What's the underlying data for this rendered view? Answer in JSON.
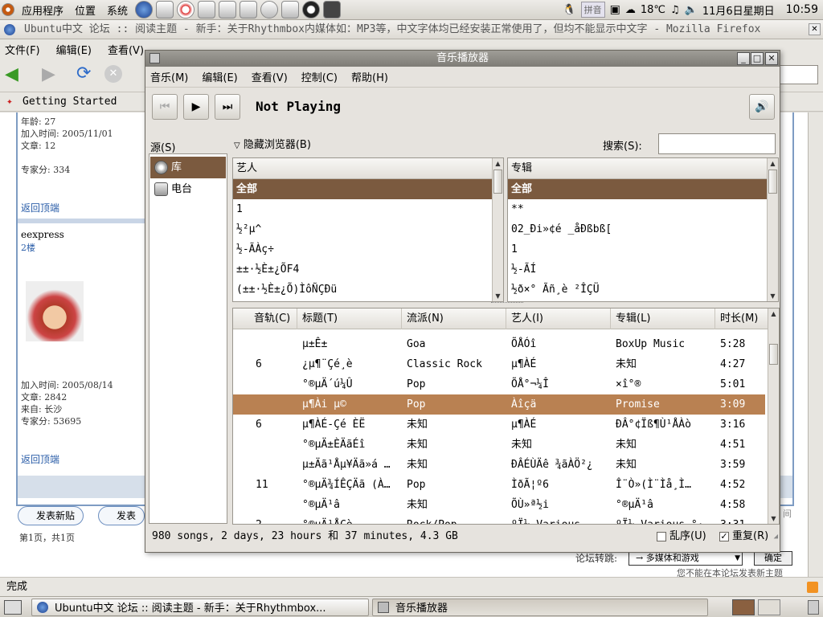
{
  "top_panel": {
    "menus": [
      "应用程序",
      "位置",
      "系统"
    ],
    "ime_label": "拼音",
    "temperature": "18℃",
    "date": "11月6日星期日",
    "time": "10:59"
  },
  "firefox": {
    "title": "Ubuntu中文 论坛 :: 阅读主题 - 新手：关于Rhythmbox内媒体如：MP3等，中文字体均已经安装正常使用了，但均不能显示中文字 - Mozilla Firefox",
    "menus": [
      "文件(F)",
      "编辑(E)",
      "查看(V)"
    ],
    "bookmark": "Getting Started",
    "status": "完成",
    "forum": {
      "post1": {
        "age": "年龄: 27",
        "joined": "加入时间: 2005/11/01",
        "posts": "文章: 12",
        "score": "专家分: 334",
        "back_top": "返回顶端"
      },
      "post2": {
        "user": "eexpress",
        "floor": "2楼",
        "joined": "加入时间: 2005/08/14",
        "posts": "文章: 2842",
        "from": "来自: 长沙",
        "score": "专家分: 53695",
        "back_top": "返回顶端"
      },
      "post_button": "发表新贴",
      "post_button2": "发表",
      "pages": "第1页，共1页",
      "jump_label": "论坛转跳:",
      "jump_value": "→ 多媒体和游戏",
      "jump_button": "确定",
      "cannot_post": "您不能在本论坛发表新主题",
      "edge_text": "间"
    }
  },
  "taskbar": {
    "items": [
      "Ubuntu中文 论坛 :: 阅读主题 - 新手：关于Rhythmbox...",
      "音乐播放器"
    ]
  },
  "rhythmbox": {
    "title": "音乐播放器",
    "menus": [
      "音乐(M)",
      "编辑(E)",
      "查看(V)",
      "控制(C)",
      "帮助(H)"
    ],
    "now_playing": "Not Playing",
    "source_label": "源(S)",
    "sources": [
      "库",
      "电台"
    ],
    "hide_browser": "隐藏浏览器(B)",
    "search_label": "搜索(S):",
    "artist_header": "艺人",
    "album_header": "专辑",
    "artists": [
      "全部",
      "1",
      "½²µ^",
      "½-ÃÀç÷",
      "±±·½È±¿ÕF4",
      "(±±·½È±¿Õ)ÌôÑÇÐü"
    ],
    "albums": [
      "全部",
      "**",
      "02_Ði»¢é  _åÐßbß[",
      "1",
      "½-ÃÍ",
      "½ð×°  Ãñ¸è ²ÎÇÜ"
    ],
    "columns": [
      "音轨(C)",
      "标题(T)",
      "流派(N)",
      "艺人(I)",
      "专辑(L)",
      "时长(M)"
    ],
    "tracks": [
      {
        "track": "",
        "title": "µ±Ê±",
        "genre": "Goa",
        "artist": "ÕÅÓî",
        "album": "BoxUp Music",
        "time": "5:28"
      },
      {
        "track": "6",
        "title": "¿µ¶¨Çé¸è",
        "genre": "Classic Rock",
        "artist": "µ¶ÀÉ",
        "album": "未知",
        "time": "4:27"
      },
      {
        "track": "",
        "title": "°®µÄ´ú¼Û",
        "genre": "Pop",
        "artist": "ÕÅ°¬¼Î",
        "album": "×î°®",
        "time": "5:01"
      },
      {
        "track": "",
        "title": "µ¶Ài µ©",
        "genre": "Pop",
        "artist": "Àîçä",
        "album": "Promise",
        "time": "3:09"
      },
      {
        "track": "6",
        "title": "µ¶ÀÉ-Çé ÈË",
        "genre": "未知",
        "artist": "µ¶ÀÉ",
        "album": "ÐÂ°¢Ïß¶Ù¹ÅÀò",
        "time": "3:16"
      },
      {
        "track": "",
        "title": "°®µÄ±ÈÄãÉî",
        "genre": "未知",
        "artist": "未知",
        "album": "未知",
        "time": "4:51"
      },
      {
        "track": "",
        "title": "µ±Äã¹Åµ¥Äã»á …",
        "genre": "未知",
        "artist": "ÐÂÉÙÄê ¾ãÀÖ²¿",
        "album": "未知",
        "time": "3:59"
      },
      {
        "track": "11",
        "title": "°®µÄ¾ÍÊÇÄã (À…",
        "genre": "Pop",
        "artist": "ÌðÃ¦º6",
        "album": "Î¨Ò»(Ì¨Ìå¸Ì…",
        "time": "4:52"
      },
      {
        "track": "",
        "title": "°®µÄ¹â",
        "genre": "未知",
        "artist": "ÕÙ»ª½i",
        "album": "°®µÄ¹â",
        "time": "4:58"
      },
      {
        "track": "2",
        "title": "°®µÄ¹ÅÇè",
        "genre": "Rock/Pop",
        "artist": "ºÏ¼ Various",
        "album": "ºÏ¼ Various °·…",
        "time": "3:31"
      }
    ],
    "selected_track_index": 3,
    "status": "980 songs, 2 days, 23 hours 和 37 minutes, 4.3 GB",
    "shuffle_label": "乱序(U)",
    "shuffle_checked": false,
    "repeat_label": "重复(R)",
    "repeat_checked": true
  }
}
